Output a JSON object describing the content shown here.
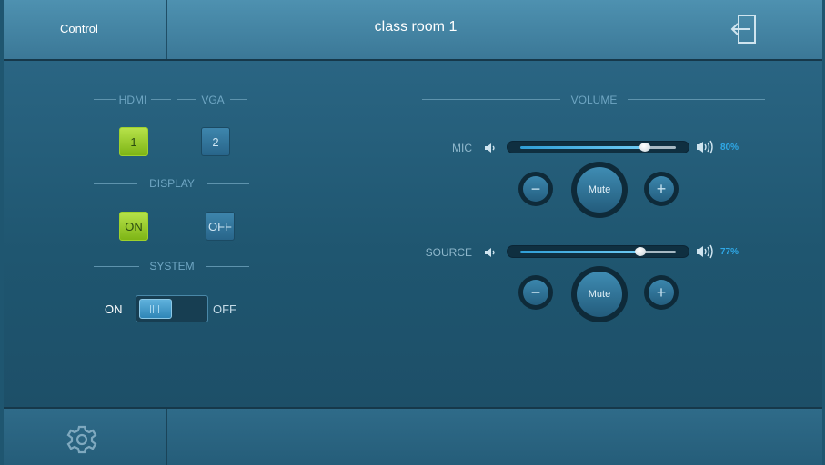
{
  "header": {
    "nav_label": "Control",
    "room_title": "class room 1",
    "exit_icon": "exit-door-icon"
  },
  "video": {
    "hdmi_label": "HDMI",
    "vga_label": "VGA",
    "hdmi_button": "1",
    "vga_button": "2",
    "selected": "HDMI"
  },
  "display": {
    "label": "DISPLAY",
    "on_label": "ON",
    "off_label": "OFF",
    "state": "ON"
  },
  "system": {
    "label": "SYSTEM",
    "on_label": "ON",
    "off_label": "OFF",
    "state": "ON"
  },
  "volume": {
    "label": "VOLUME",
    "channels": [
      {
        "name": "MIC",
        "level": 0.8,
        "percent_text": "80%",
        "minus": "−",
        "mute": "Mute",
        "plus": "+"
      },
      {
        "name": "SOURCE",
        "level": 0.77,
        "percent_text": "77%",
        "minus": "−",
        "mute": "Mute",
        "plus": "+"
      }
    ]
  },
  "footer": {
    "settings_icon": "gear-icon"
  },
  "colors": {
    "accent_green": "#8ec21d",
    "accent_blue": "#2fa8e6",
    "background": "#1f5670"
  }
}
